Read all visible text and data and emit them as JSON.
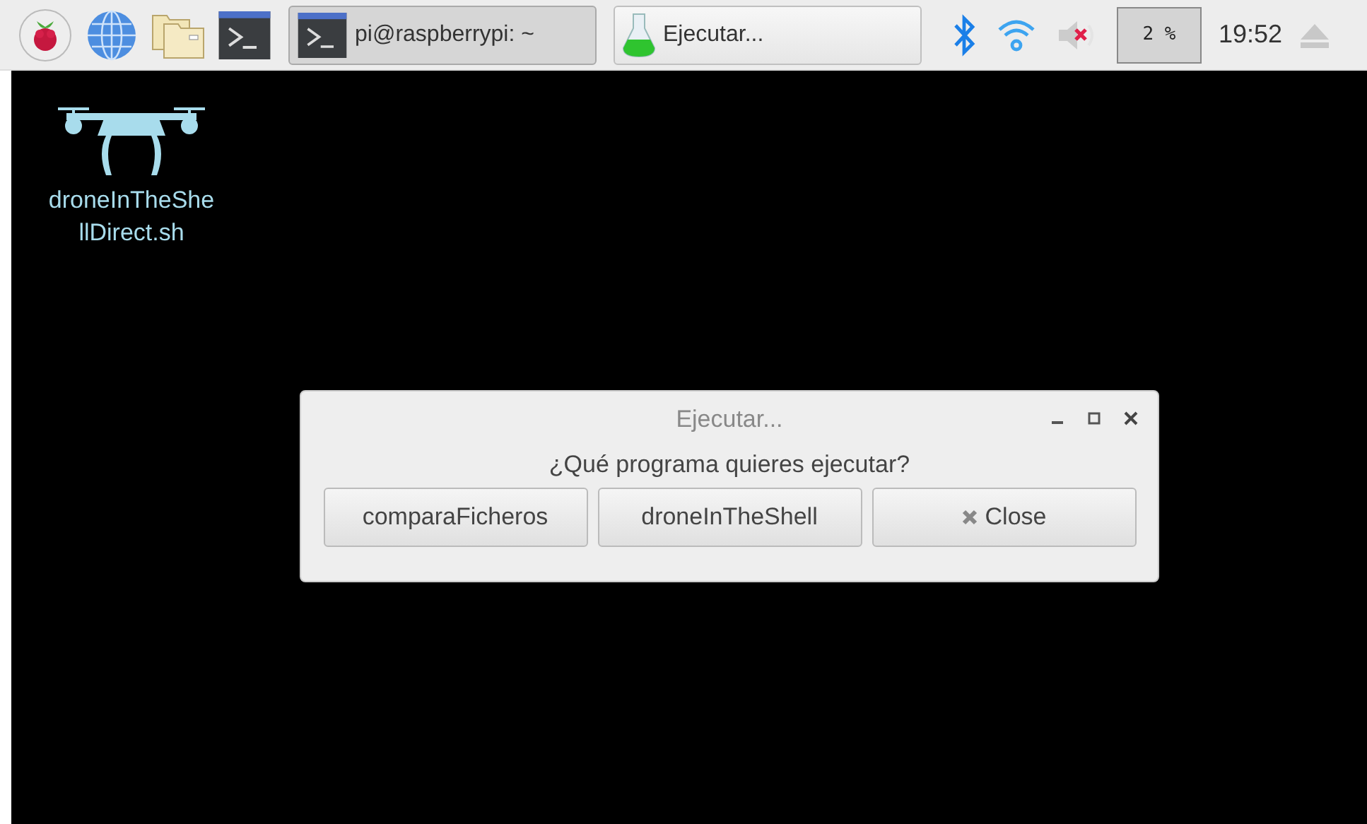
{
  "taskbar": {
    "launchers": [
      {
        "kind": "menu"
      },
      {
        "kind": "browser"
      },
      {
        "kind": "files"
      },
      {
        "kind": "terminal"
      }
    ],
    "tasks": [
      {
        "kind": "terminal",
        "label": "pi@raspberrypi: ~",
        "selected": true
      },
      {
        "kind": "flask",
        "label": "Ejecutar...",
        "selected": false
      }
    ],
    "tray": {
      "volume_muted": true,
      "cpu": "2 %",
      "clock": "19:52"
    }
  },
  "desktop": {
    "icons": [
      {
        "label_lines": [
          "droneInTheShe",
          "llDirect.sh"
        ]
      }
    ]
  },
  "dialog": {
    "title": "Ejecutar...",
    "message": "¿Qué programa quieres ejecutar?",
    "buttons": [
      {
        "label": "comparaFicheros",
        "kind": "plain"
      },
      {
        "label": "droneInTheShell",
        "kind": "plain"
      },
      {
        "label": "Close",
        "kind": "close"
      }
    ]
  }
}
